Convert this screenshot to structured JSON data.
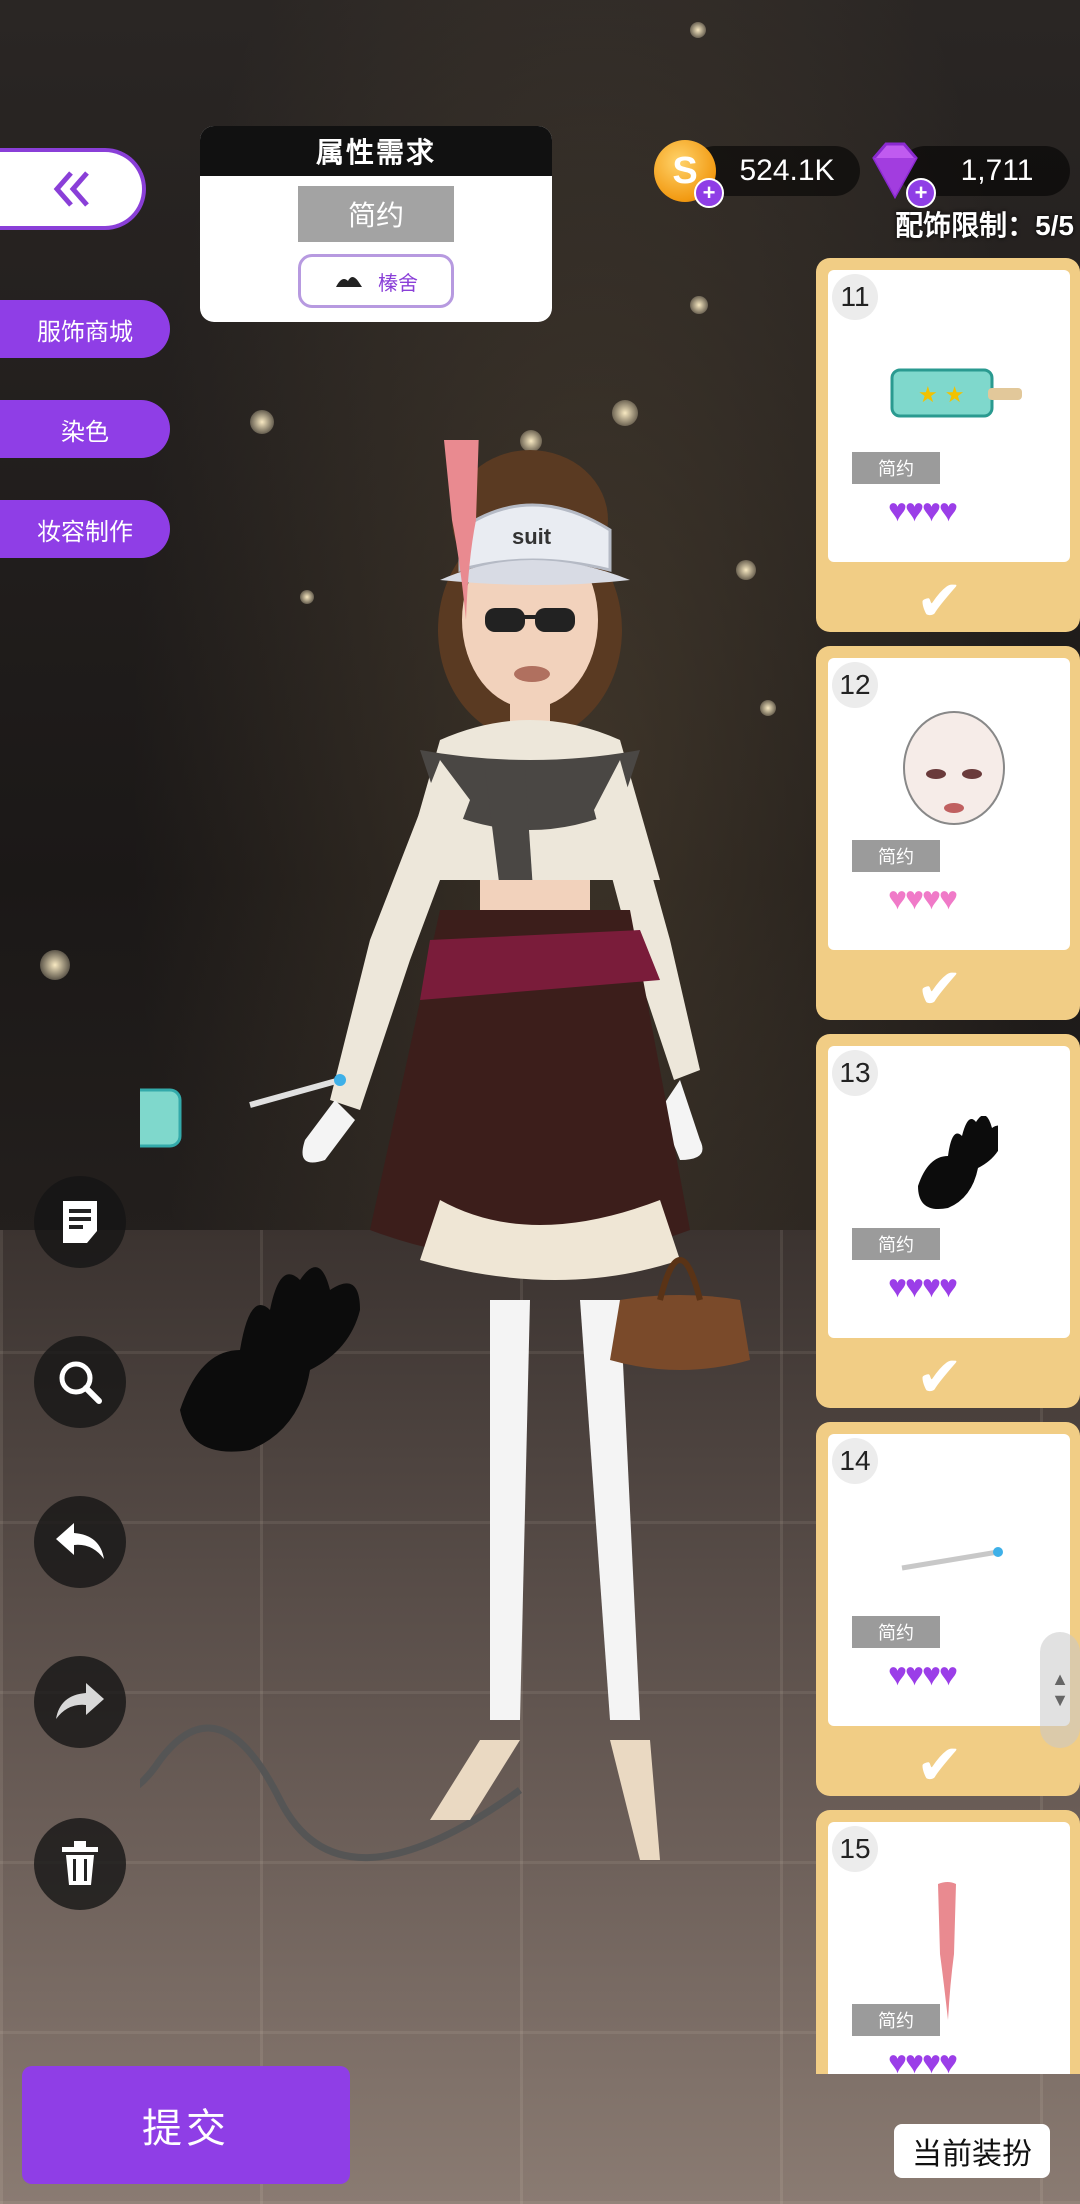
{
  "nav": {
    "back_icon": "double-chevron-left-icon",
    "side_buttons": [
      "服饰商城",
      "染色",
      "妆容制作"
    ]
  },
  "attribute_panel": {
    "title": "属性需求",
    "style_tag": "简约",
    "brand": "榛舍"
  },
  "currency": {
    "coins": "524.1K",
    "gems": "1,711"
  },
  "accessory_limit": "配饰限制：5/5",
  "items": [
    {
      "num": "11",
      "tag": "简约",
      "hearts": 4,
      "heart_color": "#9b3ee8",
      "selected": true
    },
    {
      "num": "12",
      "tag": "简约",
      "hearts": 4,
      "heart_color": "#f07ac8",
      "selected": true
    },
    {
      "num": "13",
      "tag": "简约",
      "hearts": 4,
      "heart_color": "#9b3ee8",
      "selected": true
    },
    {
      "num": "14",
      "tag": "简约",
      "hearts": 4,
      "heart_color": "#9b3ee8",
      "selected": true
    },
    {
      "num": "15",
      "tag": "简约",
      "hearts": 4,
      "heart_color": "#9b3ee8",
      "selected": false
    }
  ],
  "tools": [
    "notes-icon",
    "search-icon",
    "undo-icon",
    "redo-icon",
    "trash-icon"
  ],
  "submit_label": "提交",
  "current_outfit_label": "当前装扮",
  "colors": {
    "accent": "#8f3ee6",
    "card_bg": "#f1cd85"
  }
}
